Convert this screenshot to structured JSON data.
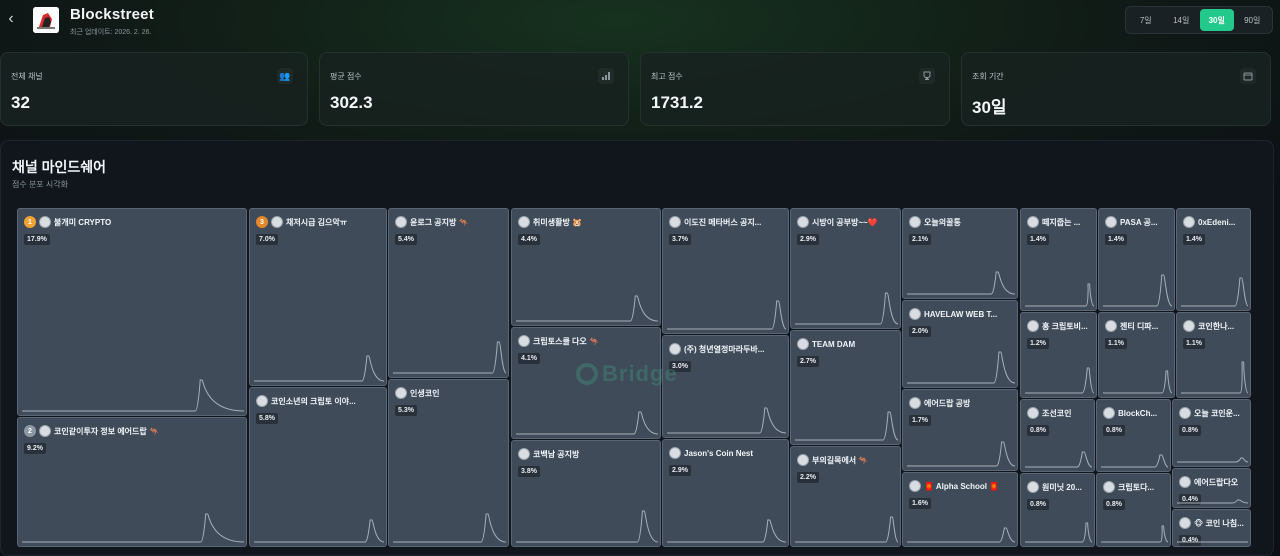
{
  "app": {
    "title": "Blockstreet",
    "updated": "최근 업데이트: 2026. 2. 26."
  },
  "range": {
    "options": [
      "7일",
      "14일",
      "30일",
      "90일"
    ],
    "active_index": 2
  },
  "stats": [
    {
      "label": "전체 채널",
      "value": "32",
      "icon": "users-icon"
    },
    {
      "label": "평균 점수",
      "value": "302.3",
      "icon": "bar-chart-icon"
    },
    {
      "label": "최고 점수",
      "value": "1731.2",
      "icon": "trophy-icon"
    },
    {
      "label": "조회 기간",
      "value": "30일",
      "icon": "calendar-icon"
    }
  ],
  "panel": {
    "title": "채널 마인드쉐어",
    "subtitle": "점수 분포 시각화"
  },
  "watermark": "Bridge",
  "colors": {
    "accent": "#22c98a",
    "tile": "#3f4b59",
    "rank1": "#f0a233",
    "rank2": "#8e98a3",
    "rank3": "#e3872b"
  },
  "channels": [
    {
      "name": "불개미 CRYPTO",
      "pct": "17.9%",
      "rank": "1"
    },
    {
      "name": "코인같이투자 정보 에어드랍 🦘",
      "pct": "9.2%",
      "rank": "2"
    },
    {
      "name": "채저시급 김으악ㅠ",
      "pct": "7.0%",
      "rank": "3"
    },
    {
      "name": "코인소년의 크립토 이야...",
      "pct": "5.8%"
    },
    {
      "name": "윤로그 공지방 🦘",
      "pct": "5.4%"
    },
    {
      "name": "인생코인",
      "pct": "5.3%"
    },
    {
      "name": "취미생활방 🐹",
      "pct": "4.4%"
    },
    {
      "name": "크립토스쿨 다오 🦘",
      "pct": "4.1%"
    },
    {
      "name": "코백남 공지방",
      "pct": "3.8%"
    },
    {
      "name": "이도진 메타버스 공지...",
      "pct": "3.7%"
    },
    {
      "name": "(주) 청년열정마라두바...",
      "pct": "3.0%"
    },
    {
      "name": "Jason's Coin Nest",
      "pct": "2.9%"
    },
    {
      "name": "시방이 공부방~~❤️",
      "pct": "2.9%"
    },
    {
      "name": "TEAM DAM",
      "pct": "2.7%"
    },
    {
      "name": "부의길목에서 🦘",
      "pct": "2.2%"
    },
    {
      "name": "오늘의꿀통",
      "pct": "2.1%"
    },
    {
      "name": "HAVELAW WEB T...",
      "pct": "2.0%"
    },
    {
      "name": "에어드랍 공방",
      "pct": "1.7%"
    },
    {
      "name": "🧧 Alpha School 🧧",
      "pct": "1.6%"
    },
    {
      "name": "떼지줍는 ...",
      "pct": "1.4%"
    },
    {
      "name": "PASA 공...",
      "pct": "1.4%"
    },
    {
      "name": "0xEdeni...",
      "pct": "1.4%"
    },
    {
      "name": "홍 크립토비...",
      "pct": "1.2%"
    },
    {
      "name": "젠티 디파...",
      "pct": "1.1%"
    },
    {
      "name": "코인한나...",
      "pct": "1.1%"
    },
    {
      "name": "조선코인",
      "pct": "0.8%"
    },
    {
      "name": "BlockCh...",
      "pct": "0.8%"
    },
    {
      "name": "오늘 코인운...",
      "pct": "0.8%"
    },
    {
      "name": "원미닛 20...",
      "pct": "0.8%"
    },
    {
      "name": "크립토다...",
      "pct": "0.8%"
    },
    {
      "name": "에어드랍다오",
      "pct": "0.4%"
    },
    {
      "name": "🐵 코인 나침...",
      "pct": "0.4%"
    }
  ]
}
